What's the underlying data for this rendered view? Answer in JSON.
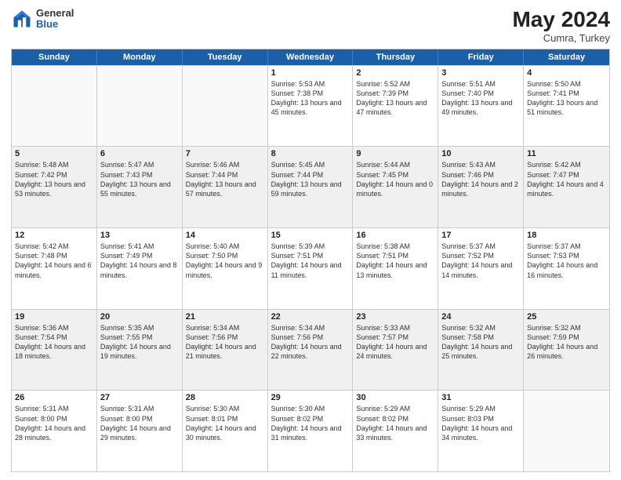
{
  "header": {
    "logo_general": "General",
    "logo_blue": "Blue",
    "month_year": "May 2024",
    "location": "Cumra, Turkey"
  },
  "calendar": {
    "days_of_week": [
      "Sunday",
      "Monday",
      "Tuesday",
      "Wednesday",
      "Thursday",
      "Friday",
      "Saturday"
    ],
    "weeks": [
      [
        {
          "day": "",
          "info": ""
        },
        {
          "day": "",
          "info": ""
        },
        {
          "day": "",
          "info": ""
        },
        {
          "day": "1",
          "info": "Sunrise: 5:53 AM\nSunset: 7:38 PM\nDaylight: 13 hours\nand 45 minutes."
        },
        {
          "day": "2",
          "info": "Sunrise: 5:52 AM\nSunset: 7:39 PM\nDaylight: 13 hours\nand 47 minutes."
        },
        {
          "day": "3",
          "info": "Sunrise: 5:51 AM\nSunset: 7:40 PM\nDaylight: 13 hours\nand 49 minutes."
        },
        {
          "day": "4",
          "info": "Sunrise: 5:50 AM\nSunset: 7:41 PM\nDaylight: 13 hours\nand 51 minutes."
        }
      ],
      [
        {
          "day": "5",
          "info": "Sunrise: 5:48 AM\nSunset: 7:42 PM\nDaylight: 13 hours\nand 53 minutes."
        },
        {
          "day": "6",
          "info": "Sunrise: 5:47 AM\nSunset: 7:43 PM\nDaylight: 13 hours\nand 55 minutes."
        },
        {
          "day": "7",
          "info": "Sunrise: 5:46 AM\nSunset: 7:44 PM\nDaylight: 13 hours\nand 57 minutes."
        },
        {
          "day": "8",
          "info": "Sunrise: 5:45 AM\nSunset: 7:44 PM\nDaylight: 13 hours\nand 59 minutes."
        },
        {
          "day": "9",
          "info": "Sunrise: 5:44 AM\nSunset: 7:45 PM\nDaylight: 14 hours\nand 0 minutes."
        },
        {
          "day": "10",
          "info": "Sunrise: 5:43 AM\nSunset: 7:46 PM\nDaylight: 14 hours\nand 2 minutes."
        },
        {
          "day": "11",
          "info": "Sunrise: 5:42 AM\nSunset: 7:47 PM\nDaylight: 14 hours\nand 4 minutes."
        }
      ],
      [
        {
          "day": "12",
          "info": "Sunrise: 5:42 AM\nSunset: 7:48 PM\nDaylight: 14 hours\nand 6 minutes."
        },
        {
          "day": "13",
          "info": "Sunrise: 5:41 AM\nSunset: 7:49 PM\nDaylight: 14 hours\nand 8 minutes."
        },
        {
          "day": "14",
          "info": "Sunrise: 5:40 AM\nSunset: 7:50 PM\nDaylight: 14 hours\nand 9 minutes."
        },
        {
          "day": "15",
          "info": "Sunrise: 5:39 AM\nSunset: 7:51 PM\nDaylight: 14 hours\nand 11 minutes."
        },
        {
          "day": "16",
          "info": "Sunrise: 5:38 AM\nSunset: 7:51 PM\nDaylight: 14 hours\nand 13 minutes."
        },
        {
          "day": "17",
          "info": "Sunrise: 5:37 AM\nSunset: 7:52 PM\nDaylight: 14 hours\nand 14 minutes."
        },
        {
          "day": "18",
          "info": "Sunrise: 5:37 AM\nSunset: 7:53 PM\nDaylight: 14 hours\nand 16 minutes."
        }
      ],
      [
        {
          "day": "19",
          "info": "Sunrise: 5:36 AM\nSunset: 7:54 PM\nDaylight: 14 hours\nand 18 minutes."
        },
        {
          "day": "20",
          "info": "Sunrise: 5:35 AM\nSunset: 7:55 PM\nDaylight: 14 hours\nand 19 minutes."
        },
        {
          "day": "21",
          "info": "Sunrise: 5:34 AM\nSunset: 7:56 PM\nDaylight: 14 hours\nand 21 minutes."
        },
        {
          "day": "22",
          "info": "Sunrise: 5:34 AM\nSunset: 7:56 PM\nDaylight: 14 hours\nand 22 minutes."
        },
        {
          "day": "23",
          "info": "Sunrise: 5:33 AM\nSunset: 7:57 PM\nDaylight: 14 hours\nand 24 minutes."
        },
        {
          "day": "24",
          "info": "Sunrise: 5:32 AM\nSunset: 7:58 PM\nDaylight: 14 hours\nand 25 minutes."
        },
        {
          "day": "25",
          "info": "Sunrise: 5:32 AM\nSunset: 7:59 PM\nDaylight: 14 hours\nand 26 minutes."
        }
      ],
      [
        {
          "day": "26",
          "info": "Sunrise: 5:31 AM\nSunset: 8:00 PM\nDaylight: 14 hours\nand 28 minutes."
        },
        {
          "day": "27",
          "info": "Sunrise: 5:31 AM\nSunset: 8:00 PM\nDaylight: 14 hours\nand 29 minutes."
        },
        {
          "day": "28",
          "info": "Sunrise: 5:30 AM\nSunset: 8:01 PM\nDaylight: 14 hours\nand 30 minutes."
        },
        {
          "day": "29",
          "info": "Sunrise: 5:30 AM\nSunset: 8:02 PM\nDaylight: 14 hours\nand 31 minutes."
        },
        {
          "day": "30",
          "info": "Sunrise: 5:29 AM\nSunset: 8:02 PM\nDaylight: 14 hours\nand 33 minutes."
        },
        {
          "day": "31",
          "info": "Sunrise: 5:29 AM\nSunset: 8:03 PM\nDaylight: 14 hours\nand 34 minutes."
        },
        {
          "day": "",
          "info": ""
        }
      ]
    ]
  }
}
